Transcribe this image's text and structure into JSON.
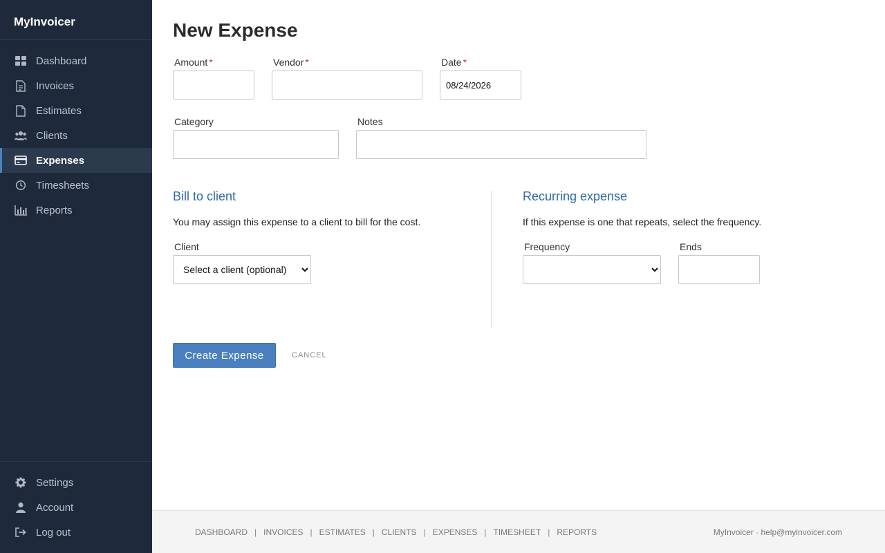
{
  "app": {
    "name": "MyInvoicer"
  },
  "sidebar": {
    "items": [
      {
        "label": "Dashboard",
        "icon": "dashboard-icon"
      },
      {
        "label": "Invoices",
        "icon": "invoice-icon"
      },
      {
        "label": "Estimates",
        "icon": "estimate-icon"
      },
      {
        "label": "Clients",
        "icon": "clients-icon"
      },
      {
        "label": "Expenses",
        "icon": "credit-card-icon",
        "active": true
      },
      {
        "label": "Timesheets",
        "icon": "clock-icon"
      },
      {
        "label": "Reports",
        "icon": "bar-chart-icon"
      }
    ],
    "bottom_items": [
      {
        "label": "Settings",
        "icon": "gear-icon"
      },
      {
        "label": "Account",
        "icon": "user-icon"
      },
      {
        "label": "Log out",
        "icon": "logout-icon"
      }
    ]
  },
  "page": {
    "title": "New Expense"
  },
  "form": {
    "amount": {
      "label": "Amount",
      "required": "*",
      "value": ""
    },
    "vendor": {
      "label": "Vendor",
      "required": "*",
      "value": ""
    },
    "date": {
      "label": "Date",
      "required": "*",
      "value": "08/24/2026"
    },
    "category": {
      "label": "Category",
      "value": ""
    },
    "notes": {
      "label": "Notes",
      "value": ""
    }
  },
  "bill_to_client": {
    "title": "Bill to client",
    "description": "You may assign this expense to a client to bill for the cost.",
    "client_label": "Client",
    "client_selected": "Select a client (optional)"
  },
  "recurring": {
    "title": "Recurring expense",
    "description": "If this expense is one that repeats, select the frequency.",
    "frequency_label": "Frequency",
    "frequency_selected": "",
    "ends_label": "Ends",
    "ends_value": ""
  },
  "actions": {
    "create_label": "Create Expense",
    "cancel_label": "CANCEL"
  },
  "footer": {
    "links": [
      "DASHBOARD",
      "INVOICES",
      "ESTIMATES",
      "CLIENTS",
      "EXPENSES",
      "TIMESHEET",
      "REPORTS"
    ],
    "separator": "|",
    "contact": "MyInvoicer · help@myinvoicer.com"
  },
  "colors": {
    "sidebar_bg": "#1e2a3b",
    "accent": "#4a80bf",
    "section_title": "#2f6aa8",
    "required": "#c0392b"
  }
}
